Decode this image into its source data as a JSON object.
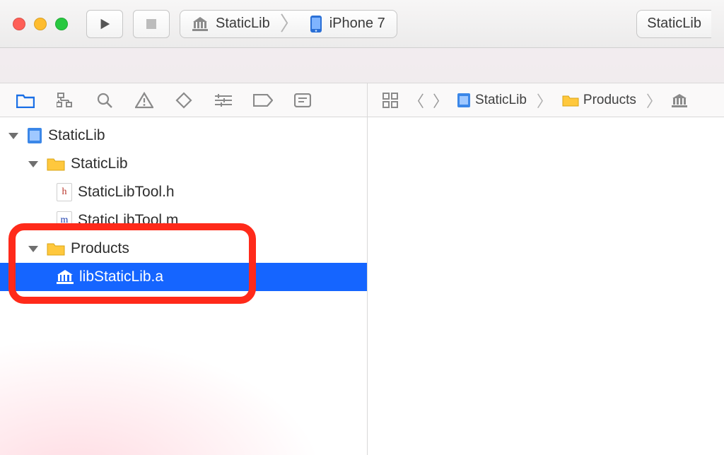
{
  "toolbar": {
    "scheme_target": "StaticLib",
    "scheme_device": "iPhone 7",
    "right_pill": "StaticLib"
  },
  "breadcrumb": {
    "seg1": "StaticLib",
    "seg2": "Products"
  },
  "tree": {
    "project": "StaticLib",
    "group1": "StaticLib",
    "file_h": "StaticLibTool.h",
    "file_m": "StaticLibTool.m",
    "group2": "Products",
    "product": "libStaticLib.a"
  }
}
